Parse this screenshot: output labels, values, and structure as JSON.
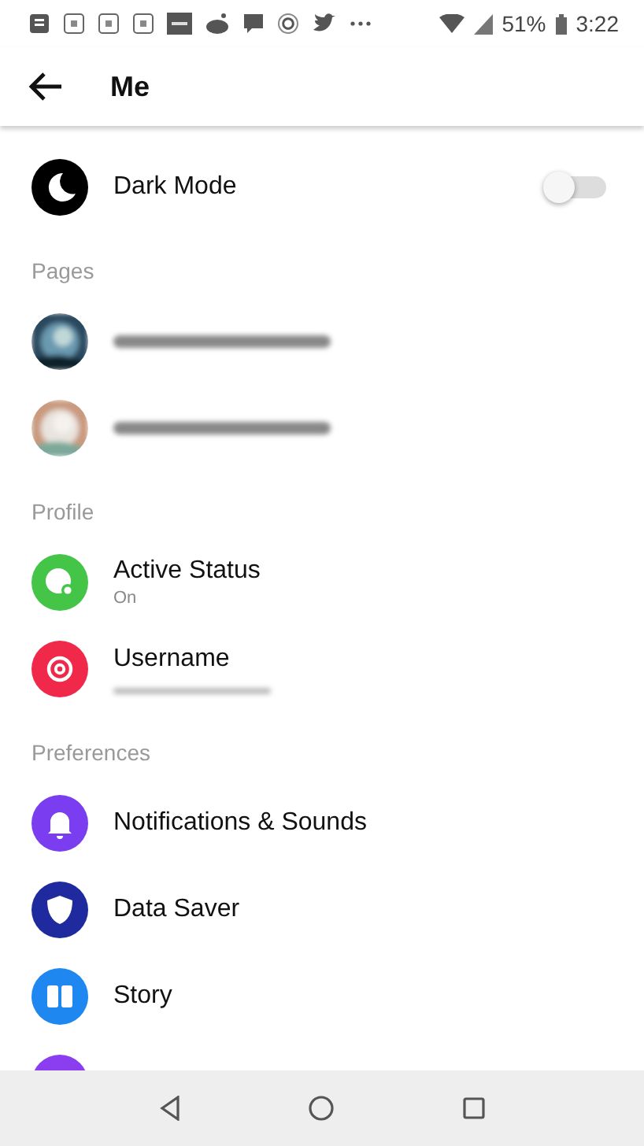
{
  "status_bar": {
    "battery": "51%",
    "time": "3:22"
  },
  "header": {
    "title": "Me"
  },
  "sections": [
    {
      "items": [
        {
          "kind": "toggle",
          "label": "Dark Mode",
          "color": "#000000",
          "on": false
        }
      ]
    },
    {
      "title": "Pages",
      "items": [
        {
          "kind": "page"
        },
        {
          "kind": "page"
        }
      ]
    },
    {
      "title": "Profile",
      "items": [
        {
          "kind": "setting",
          "label": "Active Status",
          "subtitle": "On",
          "color": "#44c548"
        },
        {
          "kind": "setting",
          "label": "Username",
          "color": "#f0284a",
          "hidden_subtitle": true
        }
      ]
    },
    {
      "title": "Preferences",
      "items": [
        {
          "kind": "setting",
          "label": "Notifications & Sounds",
          "color": "#7a3ef0"
        },
        {
          "kind": "setting",
          "label": "Data Saver",
          "color": "#1e2a9e"
        },
        {
          "kind": "setting",
          "label": "Story",
          "color": "#1e88f0"
        },
        {
          "kind": "setting",
          "color": "#8a3ef0"
        }
      ]
    }
  ]
}
